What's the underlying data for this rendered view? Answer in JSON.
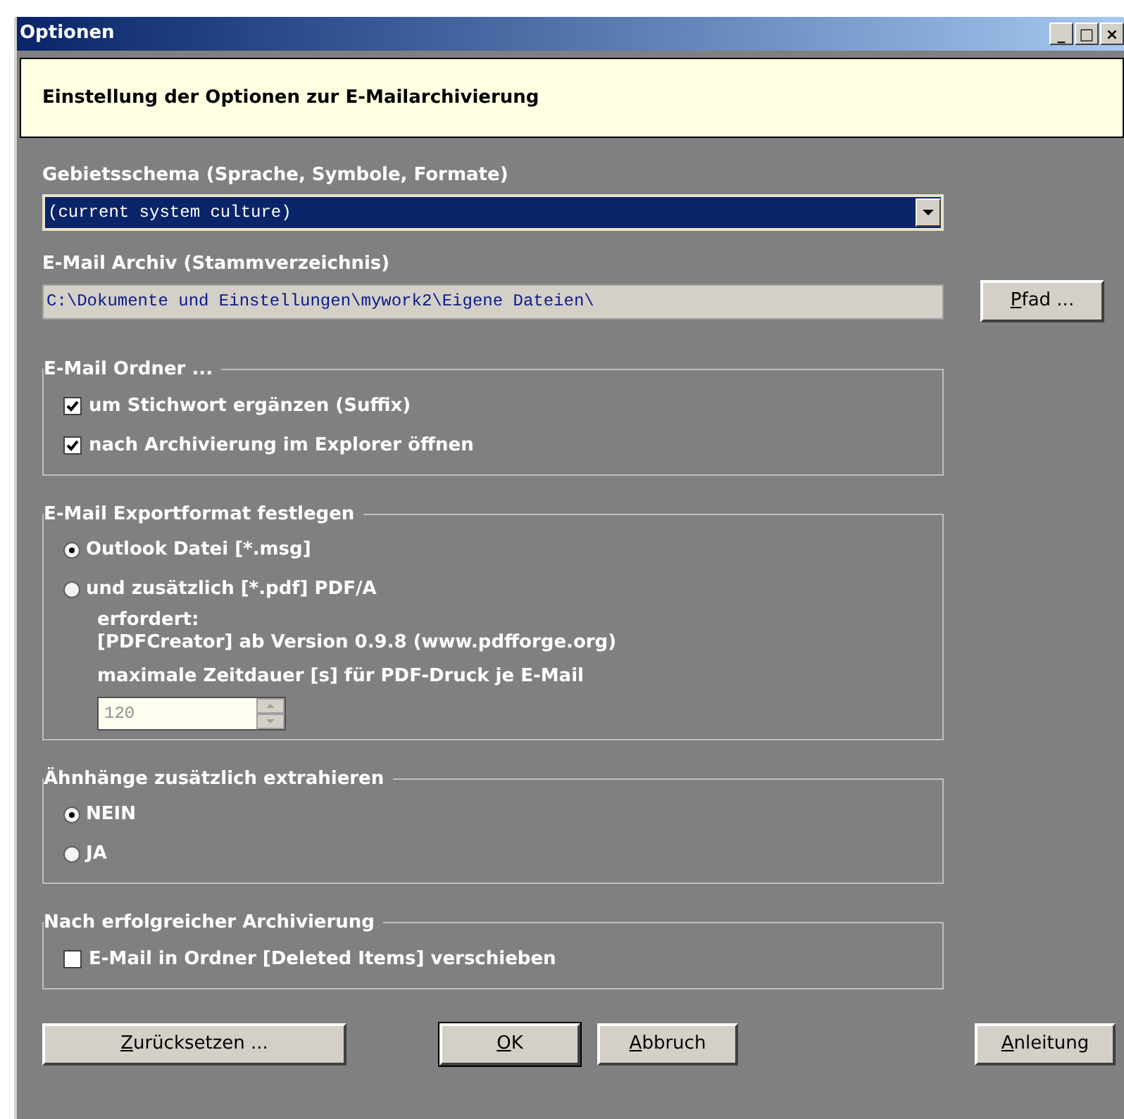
{
  "window": {
    "title": "Optionen",
    "controls": [
      "_",
      "□",
      "×"
    ]
  },
  "header": "Einstellung der Optionen zur E-Mailarchivierung",
  "locale": {
    "label": "Gebietsschema (Sprache, Symbole, Formate)",
    "value": "(current system culture)"
  },
  "archive": {
    "label": "E-Mail Archiv (Stammverzeichnis)",
    "value": "C:\\Dokumente und Einstellungen\\mywork2\\Eigene Dateien\\",
    "button": "Pfad ..."
  },
  "groups": [
    {
      "title": "E-Mail Ordner ...",
      "items": [
        {
          "kind": "checkbox",
          "label": "um Stichwort ergänzen (Suffix)",
          "checked": true
        },
        {
          "kind": "checkbox",
          "label": "nach Archivierung im Explorer öffnen",
          "checked": true
        }
      ]
    },
    {
      "title": "E-Mail Exportformat festlegen",
      "items": [
        {
          "kind": "radio",
          "label": "Outlook Datei [*.msg]",
          "selected": true
        },
        {
          "kind": "radio",
          "label": "und zusätzlich [*.pdf] PDF/A",
          "selected": false
        },
        {
          "kind": "note",
          "lines": [
            "erfordert:",
            "[PDFCreator] ab Version 0.9.8 (www.pdfforge.org)"
          ]
        },
        {
          "kind": "spinner",
          "label": "maximale Zeitdauer [s] für PDF-Druck je E-Mail",
          "value": "120"
        }
      ]
    },
    {
      "title": "Ähnhänge zusätzlich extrahieren",
      "items": [
        {
          "kind": "radio",
          "label": "NEIN",
          "selected": true
        },
        {
          "kind": "radio",
          "label": "JA",
          "selected": false
        }
      ]
    },
    {
      "title": "Nach erfolgreicher Archivierung",
      "items": [
        {
          "kind": "checkbox",
          "label": "E-Mail in Ordner [Deleted Items] verschieben",
          "checked": false
        }
      ]
    }
  ],
  "buttons": [
    {
      "label": "Zurücksetzen ...",
      "default": false
    },
    {
      "label": "OK",
      "default": true
    },
    {
      "label": "Abbruch",
      "default": false
    },
    {
      "label": "Anleitung",
      "default": false
    }
  ]
}
